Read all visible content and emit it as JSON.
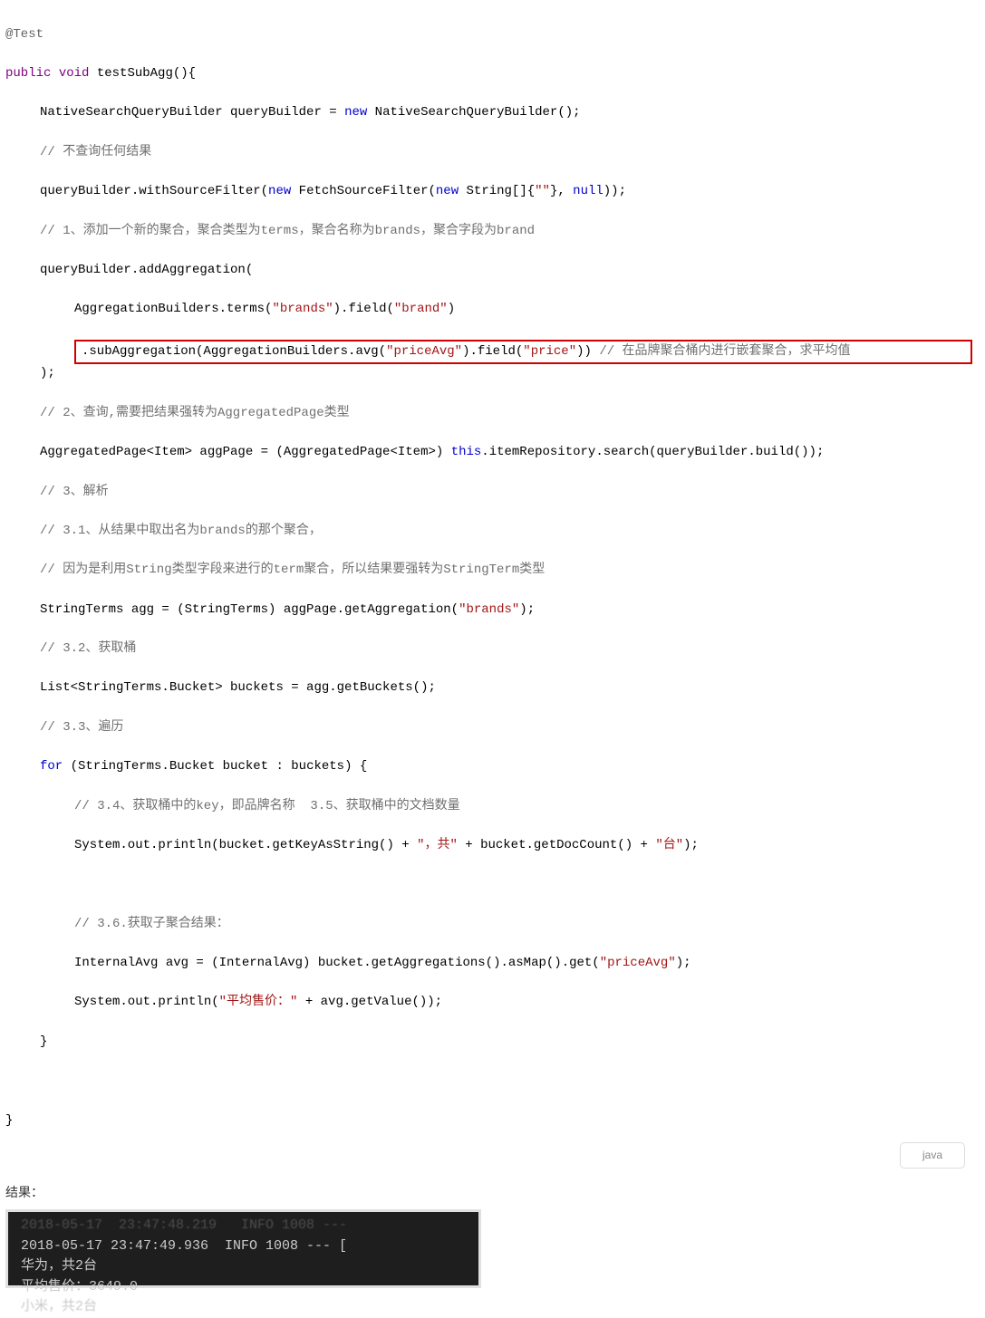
{
  "code": {
    "annotation": "@Test",
    "method_sig_public": "public",
    "method_sig_void": "void",
    "method_sig_name": "testSubAgg",
    "l1_a": "NativeSearchQueryBuilder queryBuilder = ",
    "l1_new": "new",
    "l1_b": " NativeSearchQueryBuilder();",
    "c1": "// 不查询任何结果",
    "l2_a": "queryBuilder.withSourceFilter(",
    "l2_new": "new",
    "l2_b": " FetchSourceFilter(",
    "l2_new2": "new",
    "l2_c": " String[]{",
    "l2_s": "\"\"",
    "l2_d": "}, ",
    "l2_null": "null",
    "l2_e": "));",
    "c2": "// 1、添加一个新的聚合，聚合类型为terms，聚合名称为brands，聚合字段为brand",
    "l3": "queryBuilder.addAggregation(",
    "l4_a": "AggregationBuilders.terms(",
    "l4_s1": "\"brands\"",
    "l4_b": ").field(",
    "l4_s2": "\"brand\"",
    "l4_c": ")",
    "l5_a": ".subAggregation(AggregationBuilders.avg(",
    "l5_s1": "\"priceAvg\"",
    "l5_b": ").field(",
    "l5_s2": "\"price\"",
    "l5_c": ")) ",
    "l5_comment": "// 在品牌聚合桶内进行嵌套聚合，求平均值",
    "l6": ");",
    "c3": "// 2、查询,需要把结果强转为AggregatedPage类型",
    "l7_a": "AggregatedPage<Item> aggPage = (AggregatedPage<Item>) ",
    "l7_this": "this",
    "l7_b": ".itemRepository.search(queryBuilder.build());",
    "c4": "// 3、解析",
    "c5": "// 3.1、从结果中取出名为brands的那个聚合，",
    "c6": "// 因为是利用String类型字段来进行的term聚合，所以结果要强转为StringTerm类型",
    "l8_a": "StringTerms agg = (StringTerms) aggPage.getAggregation(",
    "l8_s": "\"brands\"",
    "l8_b": ");",
    "c7": "// 3.2、获取桶",
    "l9": "List<StringTerms.Bucket> buckets = agg.getBuckets();",
    "c8": "// 3.3、遍历",
    "l10_for": "for",
    "l10_a": " (StringTerms.Bucket bucket : buckets) {",
    "c9": "// 3.4、获取桶中的key，即品牌名称  3.5、获取桶中的文档数量",
    "l11_a": "System.out.println(bucket.getKeyAsString() + ",
    "l11_s1": "\"，共\"",
    "l11_b": " + bucket.getDocCount() + ",
    "l11_s2": "\"台\"",
    "l11_c": ");",
    "c10": "// 3.6.获取子聚合结果：",
    "l12_a": "InternalAvg avg = (InternalAvg) bucket.getAggregations().asMap().get(",
    "l12_s": "\"priceAvg\"",
    "l12_b": ");",
    "l13_a": "System.out.println(",
    "l13_s": "\"平均售价：\"",
    "l13_b": " + avg.getValue());",
    "brace_close": "}"
  },
  "lang_badge": "java",
  "result_label": "结果：",
  "terminal": {
    "faded": "2018-05-17  23:47:48.219   INFO 1008 ---",
    "line1": "2018-05-17 23:47:49.936  INFO 1008 --- [",
    "line2": "华为，共2台",
    "line3": "平均售价：3649.0",
    "line4_faded": "小米，共2台"
  }
}
